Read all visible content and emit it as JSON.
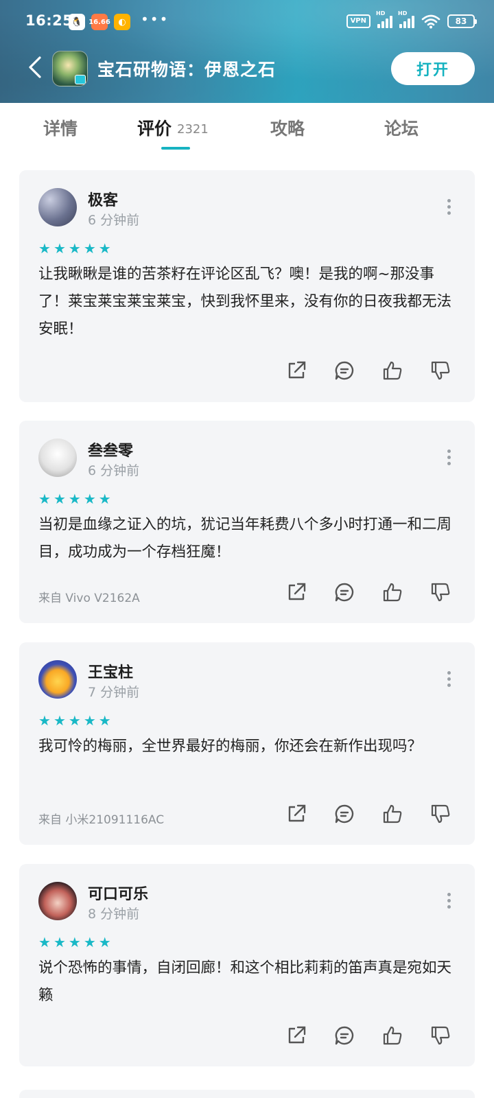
{
  "status_bar": {
    "time": "16:25",
    "notif_icons": [
      "qq-icon",
      "app-notification-icon",
      "browser-notification-icon"
    ],
    "notif2_text": "16.66",
    "more": "•••",
    "vpn": "VPN",
    "hd": "HD",
    "battery": "83"
  },
  "app_bar": {
    "title": "宝石研物语：伊恩之石",
    "open_label": "打开"
  },
  "tabs": [
    {
      "label": "详情"
    },
    {
      "label": "评价",
      "count": "2321"
    },
    {
      "label": "攻略"
    },
    {
      "label": "论坛"
    }
  ],
  "colors": {
    "accent": "#17b3c1",
    "card_bg": "#f4f5f7"
  },
  "reviews": [
    {
      "username": "极客",
      "time": "6 分钟前",
      "stars": 5,
      "content": "让我瞅瞅是谁的苦茶籽在评论区乱飞？噢！是我的啊~那没事了！莱宝莱宝莱宝莱宝，快到我怀里来，没有你的日夜我都无法安眠！",
      "device": ""
    },
    {
      "username": "叁叁零",
      "time": "6 分钟前",
      "stars": 5,
      "content": "当初是血缘之证入的坑，犹记当年耗费八个多小时打通一和二周目，成功成为一个存档狂魔！",
      "device": "来自 Vivo V2162A"
    },
    {
      "username": "王宝柱",
      "time": "7 分钟前",
      "stars": 5,
      "content": "我可怜的梅丽，全世界最好的梅丽，你还会在新作出现吗？",
      "device": "来自 小米21091116AC"
    },
    {
      "username": "可口可乐",
      "time": "8 分钟前",
      "stars": 5,
      "content": "说个恐怖的事情，自闭回廊！和这个相比莉莉的笛声真是宛如天籁",
      "device": ""
    }
  ],
  "action_icons": [
    "share-icon",
    "comment-icon",
    "thumbs-up-icon",
    "thumbs-down-icon"
  ]
}
